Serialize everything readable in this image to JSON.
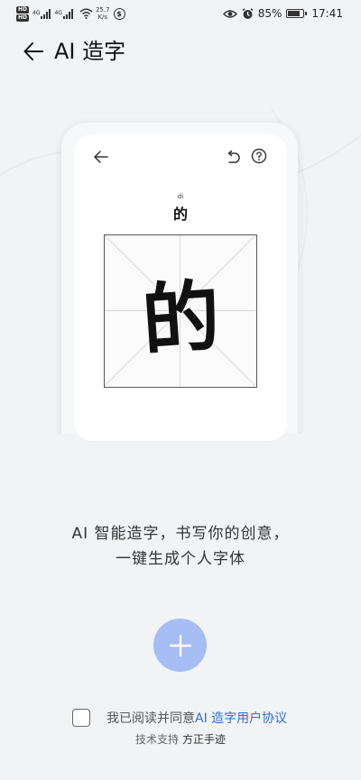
{
  "status_bar": {
    "hd1": "HD",
    "hd2": "HD",
    "net1": "4G",
    "net2": "4G",
    "speed_value": "25.7",
    "speed_unit": "K/s",
    "battery": "85%",
    "battery_level": 0.85,
    "time": "17:41"
  },
  "header": {
    "title": "AI 造字"
  },
  "preview": {
    "pinyin": "di",
    "char_label": "的",
    "big_char": "的"
  },
  "tagline": {
    "line1": "AI 智能造字，书写你的创意，",
    "line2": "一键生成个人字体"
  },
  "agreement": {
    "prefix": "我已阅读并同意",
    "link": "AI 造字用户协议"
  },
  "footer": {
    "tech_label": "技术支持",
    "brand": "方正手迹"
  },
  "colors": {
    "accent": "#2f6fd6",
    "button": "#a5bdf3",
    "background": "#f1f3f5"
  }
}
